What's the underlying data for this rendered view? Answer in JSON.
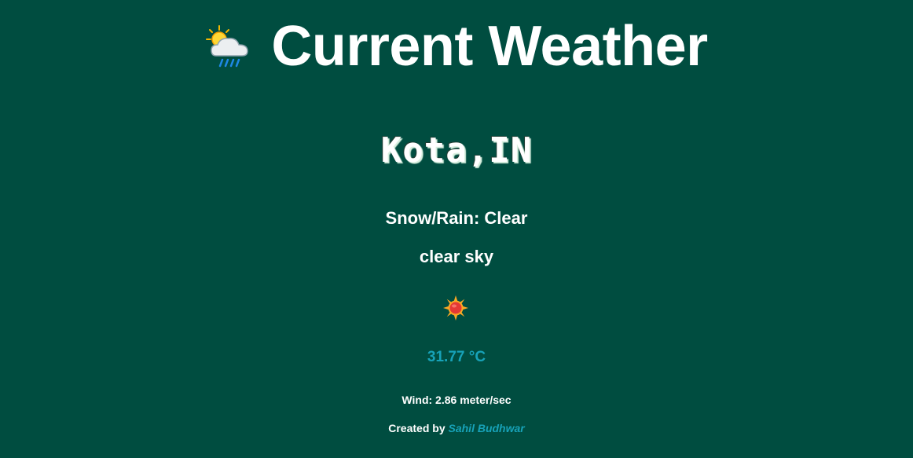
{
  "header": {
    "title": "Current Weather",
    "icon": "sun-behind-rain-cloud-icon"
  },
  "location": {
    "city": "Kota,IN"
  },
  "weather": {
    "condition": "Snow/Rain: Clear",
    "description": "clear sky",
    "icon": "sun-icon",
    "temperature": "31.77 °C",
    "wind": "Wind: 2.86 meter/sec"
  },
  "footer": {
    "created_by_label": "Created by",
    "author": "Sahil Budhwar"
  },
  "colors": {
    "background": "#004d40",
    "accent": "#17a2b8",
    "text": "#ffffff"
  }
}
